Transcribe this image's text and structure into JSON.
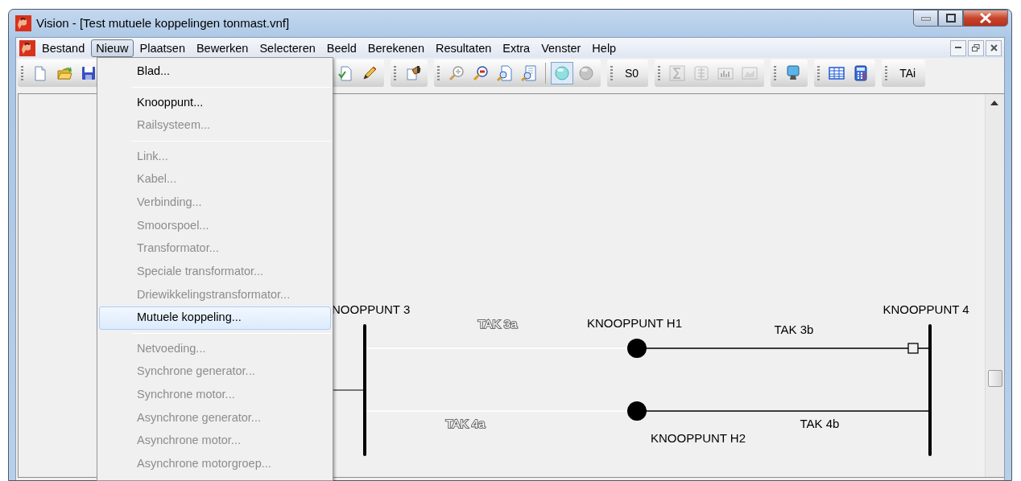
{
  "window": {
    "title": "Vision - [Test mutuele koppelingen tonmast.vnf]"
  },
  "menubar": [
    {
      "label": "Bestand",
      "selected": false
    },
    {
      "label": "Nieuw",
      "selected": true
    },
    {
      "label": "Plaatsen",
      "selected": false
    },
    {
      "label": "Bewerken",
      "selected": false
    },
    {
      "label": "Selecteren",
      "selected": false
    },
    {
      "label": "Beeld",
      "selected": false
    },
    {
      "label": "Berekenen",
      "selected": false
    },
    {
      "label": "Resultaten",
      "selected": false
    },
    {
      "label": "Extra",
      "selected": false
    },
    {
      "label": "Venster",
      "selected": false
    },
    {
      "label": "Help",
      "selected": false
    }
  ],
  "toolbar": [
    {
      "tools": [
        {
          "kind": "page"
        },
        {
          "kind": "folder"
        },
        {
          "kind": "disk"
        }
      ]
    },
    {
      "tools": [
        {
          "kind": "doccheck"
        },
        {
          "kind": "pencil"
        }
      ]
    },
    {
      "tools": [
        {
          "kind": "clipboard"
        }
      ]
    },
    {
      "tools": [
        {
          "kind": "zoomin"
        },
        {
          "kind": "zoomout"
        },
        {
          "kind": "zoompage"
        },
        {
          "kind": "zoomsheet"
        },
        {
          "kind": "separator"
        },
        {
          "kind": "ball",
          "pressed": true
        },
        {
          "kind": "ballgrey",
          "pressed": false
        }
      ]
    },
    {
      "tools": [
        {
          "kind": "text",
          "text": "S0"
        }
      ]
    },
    {
      "tools": [
        {
          "kind": "sigma",
          "disabled": true
        },
        {
          "kind": "list",
          "disabled": true
        },
        {
          "kind": "bars",
          "disabled": true
        },
        {
          "kind": "area",
          "disabled": true
        }
      ]
    },
    {
      "tools": [
        {
          "kind": "monitor"
        }
      ]
    },
    {
      "tools": [
        {
          "kind": "table"
        },
        {
          "kind": "calculator"
        }
      ]
    },
    {
      "tools": [
        {
          "kind": "text",
          "text": "TAi"
        }
      ]
    }
  ],
  "dropdown": [
    {
      "kind": "item",
      "label": "Blad...",
      "disabled": false,
      "selected": false
    },
    {
      "kind": "separator"
    },
    {
      "kind": "item",
      "label": "Knooppunt...",
      "disabled": false,
      "selected": false
    },
    {
      "kind": "item",
      "label": "Railsysteem...",
      "disabled": true,
      "selected": false
    },
    {
      "kind": "separator"
    },
    {
      "kind": "item",
      "label": "Link...",
      "disabled": true,
      "selected": false
    },
    {
      "kind": "item",
      "label": "Kabel...",
      "disabled": true,
      "selected": false
    },
    {
      "kind": "item",
      "label": "Verbinding...",
      "disabled": true,
      "selected": false
    },
    {
      "kind": "item",
      "label": "Smoorspoel...",
      "disabled": true,
      "selected": false
    },
    {
      "kind": "item",
      "label": "Transformator...",
      "disabled": true,
      "selected": false
    },
    {
      "kind": "item",
      "label": "Speciale transformator...",
      "disabled": true,
      "selected": false
    },
    {
      "kind": "item",
      "label": "Driewikkelingstransformator...",
      "disabled": true,
      "selected": false
    },
    {
      "kind": "item",
      "label": "Mutuele koppeling...",
      "disabled": false,
      "selected": true
    },
    {
      "kind": "separator"
    },
    {
      "kind": "item",
      "label": "Netvoeding...",
      "disabled": true,
      "selected": false
    },
    {
      "kind": "item",
      "label": "Synchrone generator...",
      "disabled": true,
      "selected": false
    },
    {
      "kind": "item",
      "label": "Synchrone motor...",
      "disabled": true,
      "selected": false
    },
    {
      "kind": "item",
      "label": "Asynchrone generator...",
      "disabled": true,
      "selected": false
    },
    {
      "kind": "item",
      "label": "Asynchrone motor...",
      "disabled": true,
      "selected": false
    },
    {
      "kind": "item",
      "label": "Asynchrone motorgroep...",
      "disabled": true,
      "selected": false
    }
  ],
  "diagram": {
    "nodes": [
      {
        "label": "NOOPPUNT 3",
        "kind": "bus"
      },
      {
        "label": "KNOOPPUNT H1",
        "kind": "dot"
      },
      {
        "label": "KNOOPPUNT 4",
        "kind": "bus"
      },
      {
        "label": "KNOOPPUNT H2",
        "kind": "dot"
      }
    ],
    "branches": [
      {
        "label": "TAK 3a",
        "color": "#ffffff",
        "kind": "plain"
      },
      {
        "label": "TAK 3b",
        "color": "#000000",
        "kind": "switched"
      },
      {
        "label": "TAK 4a",
        "color": "#ffffff",
        "kind": "plain"
      },
      {
        "label": "TAK 4b",
        "color": "#000000",
        "kind": "plain"
      }
    ]
  }
}
